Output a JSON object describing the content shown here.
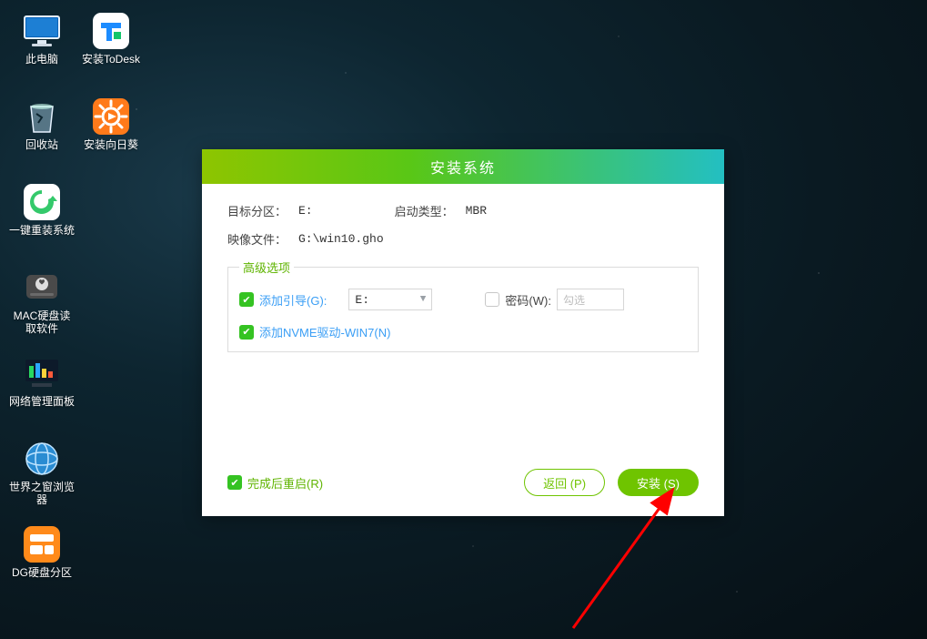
{
  "desktop": {
    "icons": [
      {
        "label": "此电脑",
        "name": "this-pc"
      },
      {
        "label": "安装ToDesk",
        "name": "install-todesk"
      },
      {
        "label": "回收站",
        "name": "recycle-bin"
      },
      {
        "label": "安装向日葵",
        "name": "install-sunlogin"
      },
      {
        "label": "一键重装系统",
        "name": "one-click-reinstall"
      },
      {
        "label": "",
        "name": "empty-slot-1"
      },
      {
        "label": "MAC硬盘读取软件",
        "name": "mac-disk-reader"
      },
      {
        "label": "",
        "name": "empty-slot-2"
      },
      {
        "label": "网络管理面板",
        "name": "network-panel"
      },
      {
        "label": "",
        "name": "empty-slot-3"
      },
      {
        "label": "世界之窗浏览器",
        "name": "theworld-browser"
      },
      {
        "label": "",
        "name": "empty-slot-4"
      },
      {
        "label": "DG硬盘分区",
        "name": "diskgenius"
      }
    ]
  },
  "dialog": {
    "title": "安装系统",
    "target_label": "目标分区：",
    "target_value": "E:",
    "boot_label": "启动类型：",
    "boot_value": "MBR",
    "image_label": "映像文件：",
    "image_value": "G:\\win10.gho",
    "advanced_legend": "高级选项",
    "add_boot_label": "添加引导(G):",
    "add_boot_value": "E:",
    "password_label": "密码(W):",
    "password_placeholder": "勾选",
    "nvme_label": "添加NVME驱动-WIN7(N)",
    "restart_label": "完成后重启(R)",
    "back_button": "返回 (P)",
    "install_button": "安装 (S)"
  }
}
